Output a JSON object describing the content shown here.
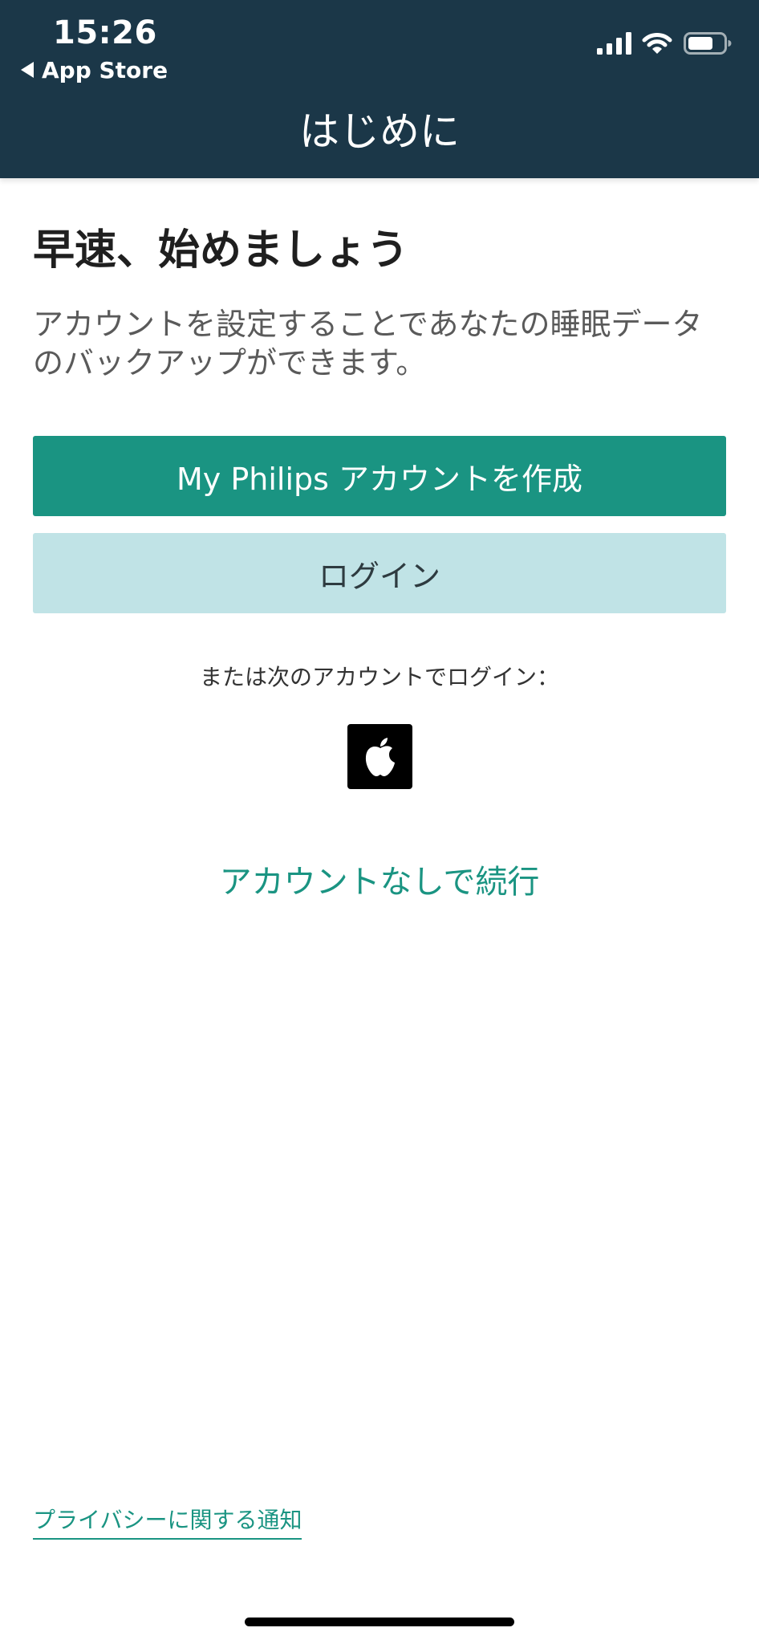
{
  "status_bar": {
    "time": "15:26",
    "back_label": "App Store"
  },
  "nav": {
    "title": "はじめに"
  },
  "main": {
    "heading": "早速、始めましょう",
    "description": "アカウントを設定することであなたの睡眠データのバックアップができます。",
    "create_account_label": "My Philips アカウントを作成",
    "login_label": "ログイン",
    "alt_login_text": "または次のアカウントでログイン：",
    "continue_label": "アカウントなしで続行"
  },
  "footer": {
    "privacy_label": "プライバシーに関する通知"
  },
  "colors": {
    "header_bg": "#1b3748",
    "primary": "#1a9482",
    "secondary_bg": "#c0e3e6"
  }
}
